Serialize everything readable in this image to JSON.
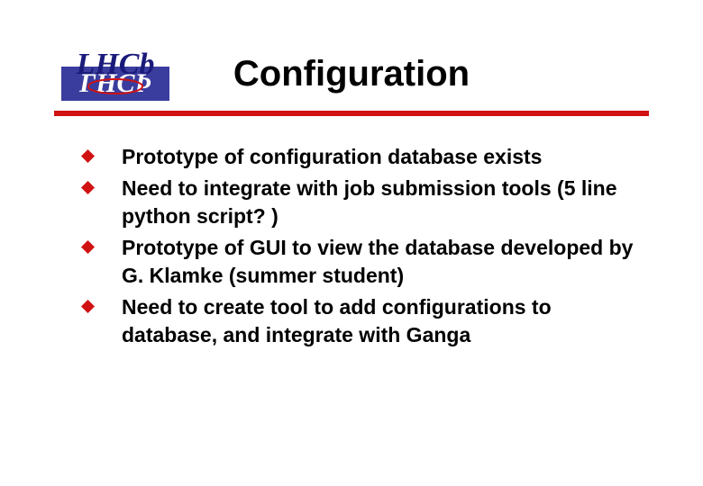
{
  "logo": {
    "text_upper": "LHCb",
    "text_lower": "ΓΗCÞ",
    "bg": "#3a3d9e",
    "fg_upper": "#1a1a7a",
    "fg_lower": "#ffffff",
    "accent": "#d01212"
  },
  "title": "Configuration",
  "rule_color": "#d01212",
  "bullet_color": "#d01212",
  "bullets": [
    "Prototype of configuration database exists",
    "Need to integrate with job submission tools (5 line python script? )",
    "Prototype of GUI to view the database developed by G. Klamke (summer student)",
    "Need to create tool to add configurations to database, and integrate with Ganga"
  ]
}
